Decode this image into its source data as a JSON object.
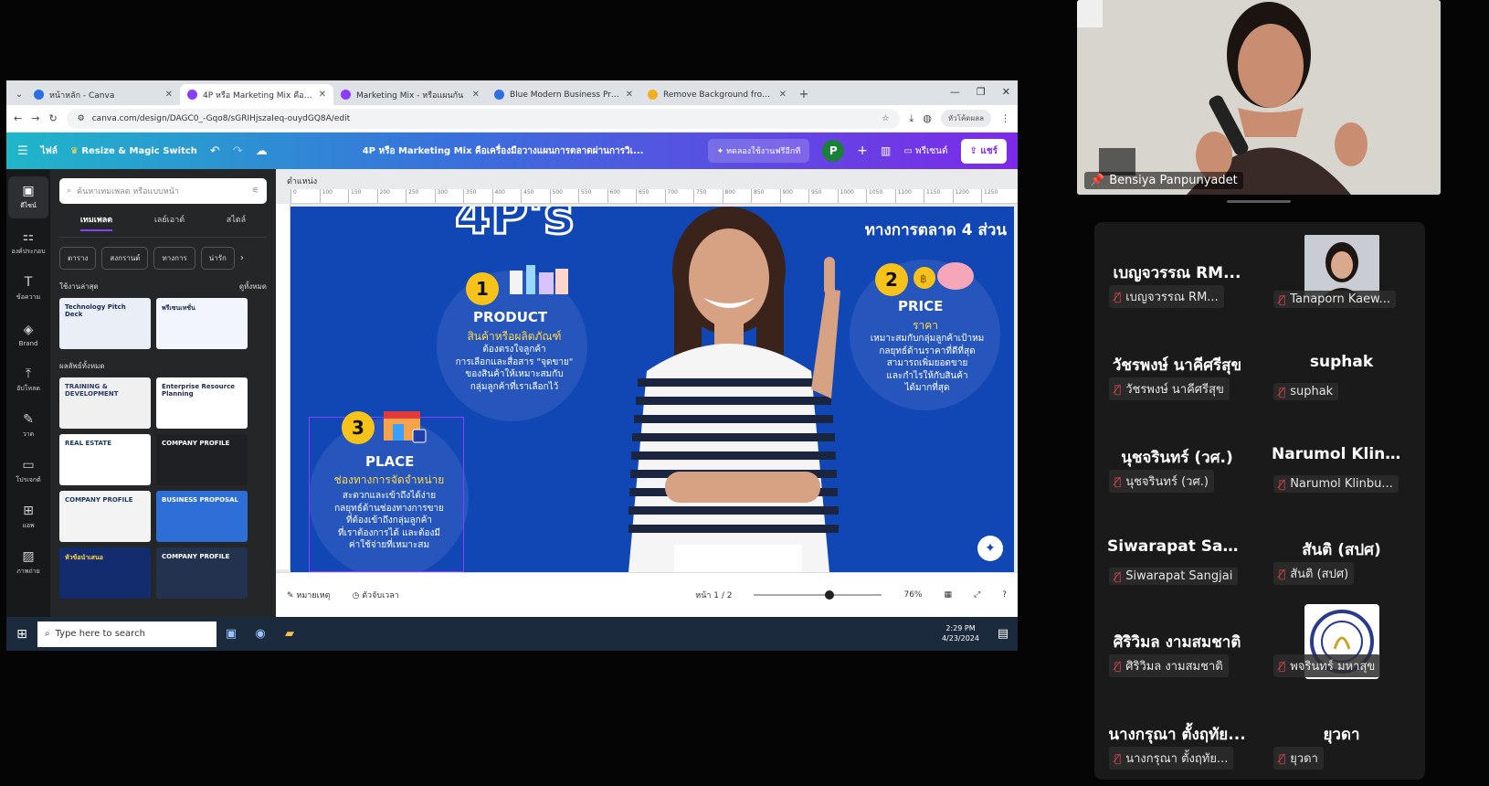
{
  "browser": {
    "tabs": [
      {
        "label": "หน้าหลัก - Canva",
        "color": "#2f6fe4",
        "active": false
      },
      {
        "label": "4P หรือ Marketing Mix คือเครื่องมือ",
        "color": "#8b3dff",
        "active": true
      },
      {
        "label": "Marketing Mix - หรือแผนกัน",
        "color": "#8b3dff",
        "active": false
      },
      {
        "label": "Blue Modern Business Propo",
        "color": "#2f6fe4",
        "active": false
      },
      {
        "label": "Remove Background from Ima",
        "color": "#f2b01e",
        "active": false
      }
    ],
    "url": "canva.com/design/DAGC0_-Gqo8/sGRIHjszaIeq-ouydGQ8A/edit",
    "profile_label": "หัวโค้ดผลล"
  },
  "canva": {
    "header": {
      "menu": "ไฟล์",
      "resize": "Resize & Magic Switch",
      "doc_title": "4P หรือ Marketing Mix คือเครื่องมือวางแผนการตลาดผ่านการวิเ...",
      "try_free": "ทดลองใช้งานฟรีอีกที",
      "avatar_letter": "P",
      "present": "พรีเซนต์",
      "share": "แชร์"
    },
    "rail": [
      "ดีไซน์",
      "องค์ประกอบ",
      "ข้อความ",
      "Brand",
      "อัปโหลด",
      "วาด",
      "โปรเจกต์",
      "แอพ",
      "ภาพถ่าย"
    ],
    "panel": {
      "search_placeholder": "ค้นหาเทมเพลต หรือแบบหน้า",
      "tabs": [
        "เทมเพลต",
        "เลย์เอาต์",
        "สไตล์"
      ],
      "chips": [
        "ตาราง",
        "สงกรานต์",
        "ทางการ",
        "น่ารัก"
      ],
      "recent_header": "ใช้งานล่าสุด",
      "see_all": "ดูทั้งหมด",
      "all_header": "ผลลัพธ์ทั้งหมด",
      "thumbs": [
        {
          "text": "Technology Pitch Deck",
          "color": "#e9eef7",
          "ink": "#1b2b52"
        },
        {
          "text": "พรีเซนเทชั่น",
          "color": "#f2f5fb",
          "ink": "#1b2b52"
        },
        {
          "text": "TRAINING & DEVELOPMENT",
          "color": "#f0f0f0",
          "ink": "#2a3a6a"
        },
        {
          "text": "Enterprise Resource Planning",
          "color": "#fff",
          "ink": "#1e2a4a"
        },
        {
          "text": "REAL ESTATE",
          "color": "#ffffff",
          "ink": "#173a56"
        },
        {
          "text": "COMPANY PROFILE",
          "color": "#1f2024",
          "ink": "#ffffff"
        },
        {
          "text": "COMPANY PROFILE",
          "color": "#f3f3f3",
          "ink": "#1f3b62"
        },
        {
          "text": "BUSINESS PROPOSAL",
          "color": "#2d6fd6",
          "ink": "#ffffff"
        },
        {
          "text": "หัวข้อนำเสนอ",
          "color": "#122c6e",
          "ink": "#ffd54a"
        },
        {
          "text": "COMPANY PROFILE",
          "color": "#23334f",
          "ink": "#ffffff"
        }
      ]
    },
    "work": {
      "title": "ตำแหน่ง",
      "ruler": [
        "0",
        "100",
        "150",
        "200",
        "250",
        "300",
        "350",
        "400",
        "450",
        "500",
        "550",
        "600",
        "650",
        "700",
        "750",
        "800",
        "850",
        "900",
        "950",
        "1000",
        "1050",
        "1100",
        "1150",
        "1200",
        "1250"
      ]
    },
    "slide": {
      "big_title": "4P's",
      "tagline": "ทางการตลาด 4 ส่วน",
      "sections": [
        {
          "num": "1",
          "title": "PRODUCT",
          "sub": "สินค้าหรือผลิตภัณฑ์",
          "body": "ต้องตรงใจลูกค้า\nการเลือกและสื่อสาร \"จุดขาย\"\nของสินค้าให้เหมาะสมกับ\nกลุ่มลูกค้าที่เราเลือกไว้"
        },
        {
          "num": "2",
          "title": "PRICE",
          "sub": "ราคา",
          "body": "เหมาะสมกับกลุ่มลูกค้าเป้าหม\nกลยุทธ์ด้านราคาที่ดีที่สุด\nสามารถเพิ่มยอดขาย\nและกำไรให้กับสินค้า\nได้มากที่สุด"
        },
        {
          "num": "3",
          "title": "PLACE",
          "sub": "ช่องทางการจัดจำหน่าย",
          "body": "สะดวกและเข้าถึงได้ง่าย\nกลยุทธ์ด้านช่องทางการขาย\nที่ต้องเข้าถึงกลุ่มลูกค้า\nที่เราต้องการได้ และต้องมี\nค่าใช้จ่ายที่เหมาะสม"
        }
      ]
    },
    "footer": {
      "notes": "หมายเหตุ",
      "timer": "ตัวจับเวลา",
      "page": "หน้า 1 / 2",
      "zoom": "76%",
      "zoom_fraction": 0.6
    }
  },
  "taskbar": {
    "search_placeholder": "Type here to search",
    "time": "2:29 PM",
    "date": "4/23/2024"
  },
  "meeting": {
    "speaker_name": "Bensiya Panpunyadet",
    "participants": [
      {
        "big": "เบญจวรรณ  RM...",
        "label": "เบญจวรรณ  RM...",
        "type": "text"
      },
      {
        "big": "",
        "label": "Tanaporn Kaew...",
        "type": "photo"
      },
      {
        "big": "วัชรพงษ์ นาคีศรีสุข",
        "label": "วัชรพงษ์ นาคีศรีสุข",
        "type": "text"
      },
      {
        "big": "suphak",
        "label": "suphak",
        "type": "text"
      },
      {
        "big": "นุชจรินทร์ (วศ.)",
        "label": "นุชจรินทร์ (วศ.)",
        "type": "text"
      },
      {
        "big": "Narumol  Klinbu...",
        "label": "Narumol Klinbu...",
        "type": "text"
      },
      {
        "big": "Siwarapat Sangjai",
        "label": "Siwarapat Sangjai",
        "type": "text"
      },
      {
        "big": "สันติ (สปศ)",
        "label": "สันติ (สปศ)",
        "type": "text"
      },
      {
        "big": "ศิริวิมล งามสมชาติ",
        "label": "ศิริวิมล งามสมชาติ",
        "type": "text"
      },
      {
        "big": "",
        "label": "พจรินทร์ มหาสุข",
        "type": "logo"
      },
      {
        "big": "นางกรุณา ตั้งฤทัย...",
        "label": "นางกรุณา ตั้งฤทัย...",
        "type": "text"
      },
      {
        "big": "ยุวดา",
        "label": "ยุวดา",
        "type": "text"
      }
    ]
  }
}
